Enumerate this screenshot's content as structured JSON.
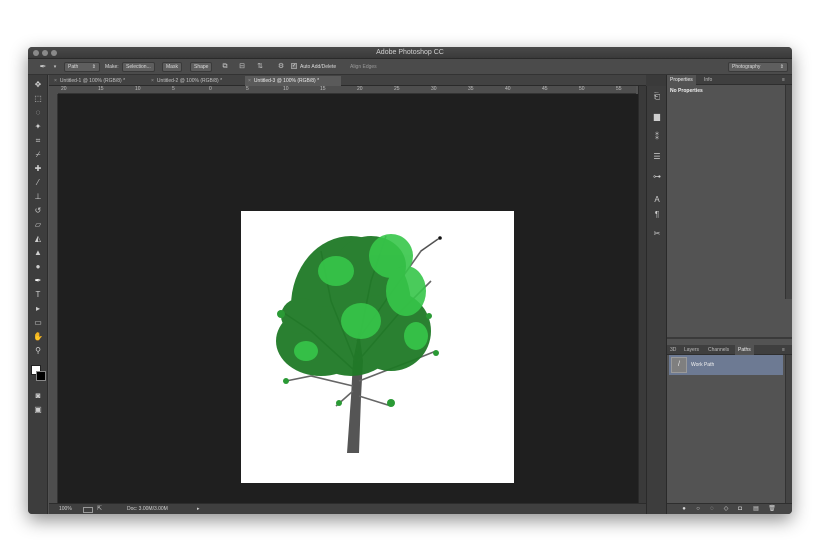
{
  "window": {
    "title": "Adobe Photoshop CC"
  },
  "options_bar": {
    "tool_mode": "Path",
    "make_label": "Make:",
    "selection_button": "Selection...",
    "mask_button": "Mask",
    "shape_button": "Shape",
    "auto_add_delete_label": "Auto Add/Delete",
    "auto_add_delete_checked": true,
    "align_edges_label": "Align Edges",
    "workspace": "Photography"
  },
  "tabs": [
    {
      "label": "Untitled-1 @ 100% (RGB/8) *",
      "active": false
    },
    {
      "label": "Untitled-2 @ 100% (RGB/8) *",
      "active": false
    },
    {
      "label": "Untitled-3 @ 100% (RGB/8) *",
      "active": true
    }
  ],
  "ruler": {
    "top_labels": [
      "20",
      "15",
      "10",
      "5",
      "0",
      "5",
      "10",
      "15",
      "20",
      "25",
      "30",
      "35",
      "40",
      "45",
      "50",
      "55"
    ]
  },
  "status": {
    "zoom": "100%",
    "doc_info": "Doc: 3.00M/3.00M"
  },
  "panels": {
    "properties": {
      "tabs": [
        {
          "label": "Properties",
          "active": true
        },
        {
          "label": "Info",
          "active": false
        }
      ],
      "content": "No Properties"
    },
    "layers": {
      "tabs": [
        {
          "label": "3D",
          "active": false
        },
        {
          "label": "Layers",
          "active": false
        },
        {
          "label": "Channels",
          "active": false
        },
        {
          "label": "Paths",
          "active": true
        }
      ],
      "paths": [
        {
          "name": "Work Path",
          "selected": true
        }
      ]
    }
  },
  "colors": {
    "window_bg": "#535353",
    "canvas_bg": "#1f1f1f",
    "document_bg": "#ffffff",
    "tree_leaf_dark": "#1f7a26",
    "tree_leaf_light": "#37c64a",
    "tree_trunk": "#555555",
    "selection_highlight": "#6d7a93"
  },
  "icons": {
    "toolbox": [
      "move-icon",
      "marquee-icon",
      "lasso-icon",
      "magic-wand-icon",
      "crop-icon",
      "eyedropper-icon",
      "healing-brush-icon",
      "brush-icon",
      "clone-stamp-icon",
      "history-brush-icon",
      "eraser-icon",
      "paint-bucket-icon",
      "blur-icon",
      "dodge-icon",
      "pen-icon",
      "type-icon",
      "path-selection-icon",
      "rectangle-icon",
      "hand-icon",
      "zoom-icon"
    ],
    "dock": [
      "history-panel-icon",
      "histogram-icon",
      "adjustments-icon",
      "brush-presets-icon",
      "character-icon",
      "paragraph-icon",
      "tools-presets-icon"
    ],
    "paths_footer": [
      "fill-path-icon",
      "stroke-path-icon",
      "load-selection-icon",
      "make-work-path-icon",
      "add-mask-icon",
      "new-path-icon",
      "delete-path-icon"
    ]
  }
}
